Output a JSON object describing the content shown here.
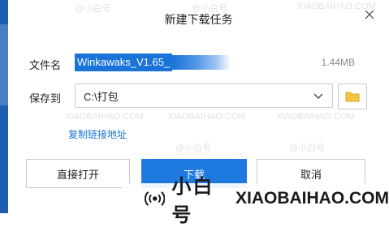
{
  "dialog": {
    "title": "新建下载任务",
    "close_glyph": "×"
  },
  "filename": {
    "label": "文件名",
    "value": "Winkawaks_V1.65_",
    "size": "1.44MB"
  },
  "save_to": {
    "label": "保存到",
    "path": "C:\\打包"
  },
  "copy_link": {
    "label": "复制链接地址"
  },
  "buttons": {
    "direct_open": "直接打开",
    "download": "下载",
    "cancel": "取消"
  },
  "watermarks": {
    "handle": "@小白号",
    "site_upper": "XIAOBAIHAO.COM"
  },
  "brand": {
    "name_cn": "小白号",
    "site": "XIAOBAIHAO.COM"
  },
  "colors": {
    "accent": "#1f7ae0",
    "link": "#1a73d9",
    "strip": "#1f5db0",
    "folder": "#f5c542"
  }
}
